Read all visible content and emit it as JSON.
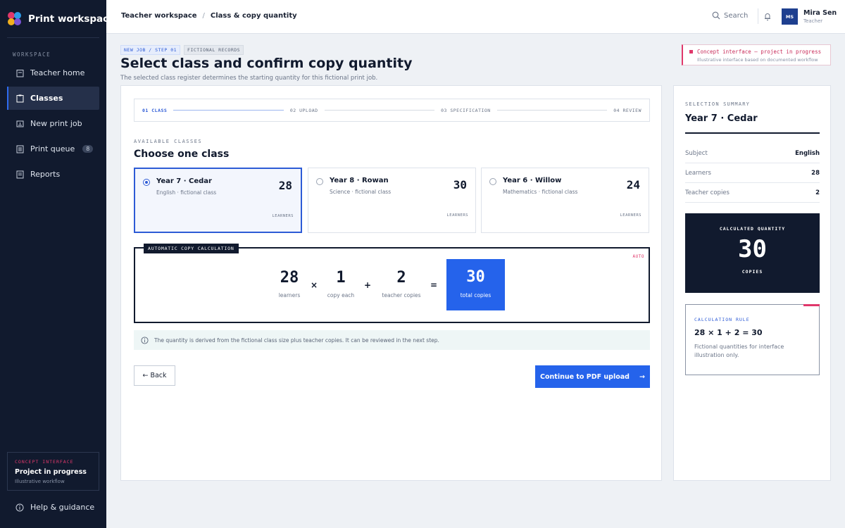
{
  "app": {
    "name": "Print workspace"
  },
  "colors": {
    "accent": "#2563eb",
    "sidebar": "#111a2e",
    "concept": "#e0386b"
  },
  "sidebar": {
    "section_label": "WORKSPACE",
    "items": [
      {
        "label": "Teacher home",
        "icon": "home-icon"
      },
      {
        "label": "Classes",
        "icon": "clipboard-icon",
        "active": true
      },
      {
        "label": "New print job",
        "icon": "print-icon"
      },
      {
        "label": "Print queue",
        "icon": "queue-icon",
        "badge": "8"
      },
      {
        "label": "Reports",
        "icon": "report-icon"
      }
    ],
    "concept": {
      "tag": "CONCEPT INTERFACE",
      "title": "Project in progress",
      "subtitle": "Illustrative workflow"
    },
    "help_label": "Help & guidance"
  },
  "header": {
    "breadcrumb": [
      "Teacher workspace",
      "Class & copy quantity"
    ],
    "search_label": "Search",
    "user": {
      "initials": "MS",
      "name": "Mira Sen",
      "role": "Teacher"
    }
  },
  "page": {
    "tags": [
      "NEW JOB / STEP 01",
      "FICTIONAL RECORDS"
    ],
    "title": "Select class and confirm copy quantity",
    "subtitle": "The selected class register determines the starting quantity for this fictional print job.",
    "concept_note": {
      "title": "Concept interface — project in progress",
      "subtitle": "Illustrative interface based on documented workflow"
    }
  },
  "steps": [
    "01 CLASS",
    "02 UPLOAD",
    "03 SPECIFICATION",
    "04 REVIEW"
  ],
  "classes": {
    "section_label": "AVAILABLE CLASSES",
    "heading": "Choose one class",
    "count_label": "LEARNERS",
    "items": [
      {
        "name": "Year 7 · Cedar",
        "subject": "English · fictional class",
        "learners": "28",
        "selected": true
      },
      {
        "name": "Year 8 · Rowan",
        "subject": "Science · fictional class",
        "learners": "30",
        "selected": false
      },
      {
        "name": "Year 6 · Willow",
        "subject": "Mathematics · fictional class",
        "learners": "24",
        "selected": false
      }
    ]
  },
  "calculation": {
    "tag": "AUTOMATIC COPY CALCULATION",
    "auto": "AUTO",
    "learners": {
      "value": "28",
      "label": "learners"
    },
    "times": "×",
    "each": {
      "value": "1",
      "label": "copy each"
    },
    "plus": "+",
    "teacher": {
      "value": "2",
      "label": "teacher copies"
    },
    "equals": "=",
    "total": {
      "value": "30",
      "label": "total copies"
    }
  },
  "info_text": "The quantity is derived from the fictional class size plus teacher copies. It can be reviewed in the next step.",
  "actions": {
    "back": "← Back",
    "continue": "Continue to PDF upload",
    "continue_arrow": "→"
  },
  "summary": {
    "label": "SELECTION SUMMARY",
    "class_name": "Year 7 · Cedar",
    "rows": [
      {
        "key": "Subject",
        "value": "English"
      },
      {
        "key": "Learners",
        "value": "28"
      },
      {
        "key": "Teacher copies",
        "value": "2"
      }
    ],
    "quantity": {
      "label": "CALCULATED QUANTITY",
      "value": "30",
      "unit": "COPIES"
    },
    "rule": {
      "label": "CALCULATION RULE",
      "equation": "28 × 1 + 2 = 30",
      "note": "Fictional quantities for interface illustration only."
    }
  }
}
